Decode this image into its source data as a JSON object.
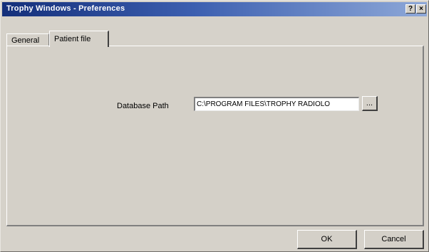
{
  "window": {
    "title": "Trophy Windows - Preferences",
    "help_label": "?",
    "close_label": "×"
  },
  "tabs": [
    {
      "label": "General",
      "active": false
    },
    {
      "label": "Patient file",
      "active": true
    }
  ],
  "patient_file": {
    "database_path_label": "Database Path",
    "database_path_value": "C:\\PROGRAM FILES\\TROPHY RADIOLO",
    "browse_label": "..."
  },
  "buttons": {
    "ok_label": "OK",
    "cancel_label": "Cancel"
  }
}
